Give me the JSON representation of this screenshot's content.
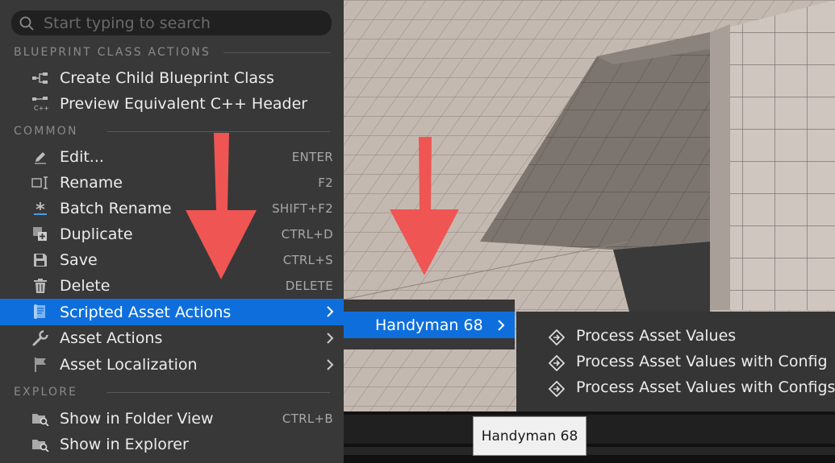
{
  "search": {
    "placeholder": "Start typing to search"
  },
  "sections": {
    "blueprint": "BLUEPRINT CLASS ACTIONS",
    "common": "COMMON",
    "explore": "EXPLORE"
  },
  "blueprint_items": [
    {
      "label": "Create Child Blueprint Class",
      "icon": "blueprint-class-icon"
    },
    {
      "label": "Preview Equivalent C++ Header",
      "icon": "cpp-header-icon"
    }
  ],
  "common_items": [
    {
      "label": "Edit...",
      "shortcut": "ENTER",
      "icon": "pencil-icon"
    },
    {
      "label": "Rename",
      "shortcut": "F2",
      "icon": "rename-icon"
    },
    {
      "label": "Batch Rename",
      "shortcut": "SHIFT+F2",
      "icon": "batch-rename-icon"
    },
    {
      "label": "Duplicate",
      "shortcut": "CTRL+D",
      "icon": "duplicate-icon"
    },
    {
      "label": "Save",
      "shortcut": "CTRL+S",
      "icon": "save-icon"
    },
    {
      "label": "Delete",
      "shortcut": "DELETE",
      "icon": "trash-icon"
    },
    {
      "label": "Scripted Asset Actions",
      "icon": "script-icon",
      "submenu": true
    },
    {
      "label": "Asset Actions",
      "icon": "wrench-icon",
      "submenu": true
    },
    {
      "label": "Asset Localization",
      "icon": "flag-icon",
      "submenu": true
    }
  ],
  "explore_items": [
    {
      "label": "Show in Folder View",
      "shortcut": "CTRL+B",
      "icon": "folder-search-icon"
    },
    {
      "label": "Show in Explorer",
      "icon": "folder-search-icon"
    }
  ],
  "submenu1": {
    "label": "Handyman 68"
  },
  "submenu2": {
    "items": [
      {
        "label": "Process Asset Values",
        "icon": "diamond-arrow-icon"
      },
      {
        "label": "Process Asset Values with Config",
        "icon": "diamond-arrow-icon"
      },
      {
        "label": "Process Asset Values with Configs",
        "icon": "diamond-arrow-icon"
      }
    ]
  },
  "tooltip": {
    "text": "Handyman 68"
  },
  "colors": {
    "menu_bg": "#383838",
    "highlight": "#0e6fdc",
    "arrow": "#ef5553",
    "floor": "#c2b6ae"
  }
}
